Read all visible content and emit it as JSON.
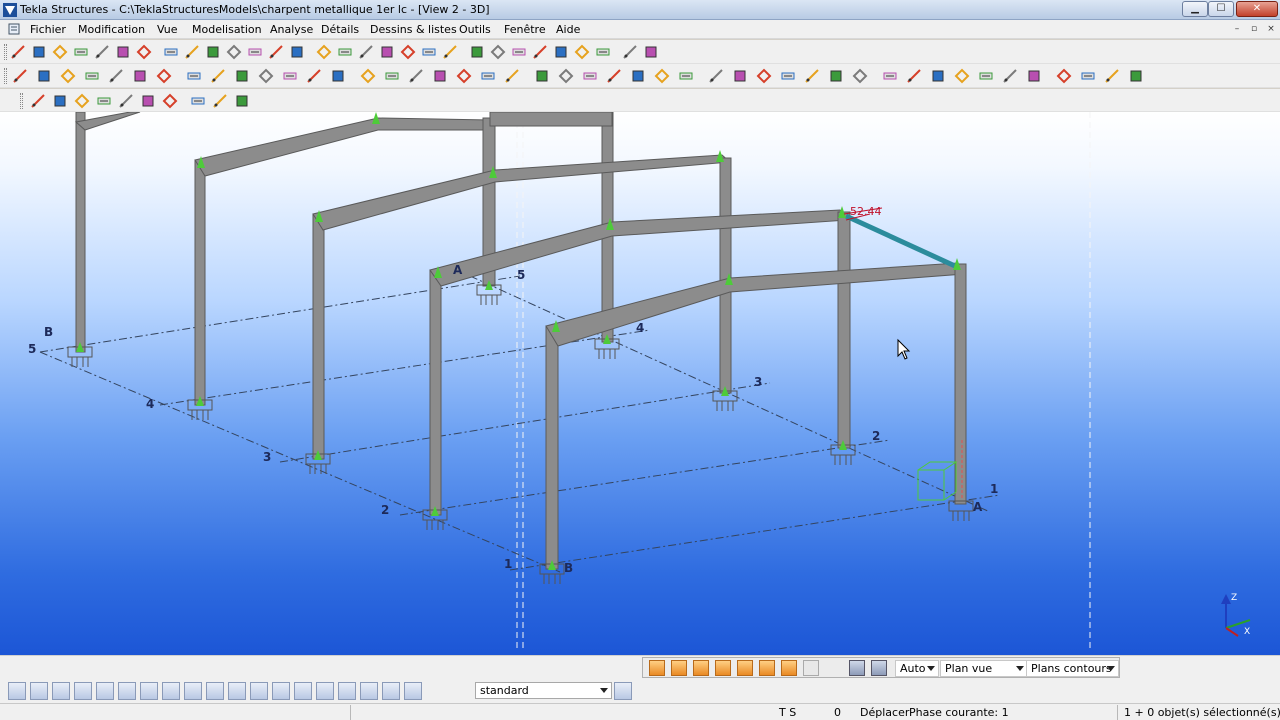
{
  "window": {
    "title": "Tekla Structures - C:\\TeklaStructuresModels\\charpent metallique 1er lc - [View 2 - 3D]",
    "minimize": "▁",
    "maximize": "☐",
    "close": "✕"
  },
  "menu": {
    "items": [
      "Fichier",
      "Modification",
      "Vue",
      "Modelisation",
      "Analyse",
      "Détails",
      "Dessins & listes",
      "Outils",
      "Fenêtre",
      "Aide"
    ],
    "mdi_minimize": "–",
    "mdi_restore": "▫",
    "mdi_close": "×"
  },
  "viewport": {
    "dimension_label": "52.44",
    "grid_labels": {
      "frame_numbers": [
        "1",
        "2",
        "3",
        "4",
        "5"
      ],
      "axis_letters": [
        "A",
        "B"
      ]
    },
    "axes_triad": {
      "z": "Z",
      "x": "X"
    }
  },
  "snap_bar": {
    "work_plane_handler": "Auto",
    "view_plane": "Plan vue",
    "contour_planes": "Plans contours"
  },
  "settings": {
    "selection_settings": "standard"
  },
  "status": {
    "ts": "T S",
    "counter": "0",
    "command": "Déplacer",
    "phase": "Phase courante: 1",
    "selection": "1 + 0 objet(s) sélectionné(s)"
  },
  "colors": {
    "steel": "#8c8c8c",
    "selected_member": "#2c8c9c",
    "grid_line": "#34445e",
    "marker": "#4ecb3a"
  },
  "icons": {
    "tb1": [
      "point-icon",
      "point-on-line-icon",
      "point-on-plane-icon",
      "intersection-point-icon",
      "arc-point-icon",
      "circle-point-icon",
      "grid-icon",
      "gridline-icon",
      "view-icon",
      "viewport-icon",
      "prev-view-icon",
      "next-view-icon",
      "three-d-icon",
      "zoom-in-icon",
      "zoom-out-icon",
      "zoom-window-icon",
      "zoom-all-icon",
      "center-icon",
      "pan-icon",
      "rotate-icon",
      "fly-icon",
      "clip-plane-icon",
      "work-area-icon",
      "dim-icon",
      "measure-icon",
      "distance-icon",
      "angle-icon",
      "bolt-distance-icon",
      "filter-icon",
      "layer-icon"
    ],
    "tb2": [
      "column-icon",
      "beam-icon",
      "polybeam-icon",
      "curved-beam-icon",
      "contour-plate-icon",
      "bolt-icon",
      "weld-icon",
      "fitting-icon",
      "component-icon",
      "cut-icon",
      "polygon-cut-icon",
      "new-icon",
      "open-icon",
      "save-icon",
      "undo-icon",
      "redo-icon",
      "copy-icon",
      "move-icon",
      "mirror-icon",
      "properties-icon",
      "select-all-icon",
      "select-parts-icon",
      "select-assembly-icon",
      "select-objects-icon",
      "select-points-icon",
      "drawing-icon",
      "single-drawing-icon",
      "assembly-drawing-icon",
      "cast-drawing-icon",
      "report-icon",
      "numbering-icon",
      "inquire-icon",
      "help-icon",
      "snap-end-icon",
      "snap-mid-icon",
      "snap-intersect-icon",
      "snap-perp-icon",
      "snap-line-icon",
      "analysis-icon",
      "load-icon",
      "catalog-icon",
      "profile-icon",
      "material-icon",
      "web-icon",
      "macro-icon",
      "tools-icon"
    ],
    "tb3": [
      "solid-icon",
      "wireframe-icon",
      "beam-rep-icon",
      "line-rep-icon",
      "slab-icon",
      "panel-icon",
      "hatch-icon",
      "magnet-icon",
      "rotate-tool-icon",
      "mesh-icon"
    ],
    "bottom": [
      "select-icon",
      "select-components-icon",
      "select-parts-bottom-icon",
      "select-surface-icon",
      "select-bolts-icon",
      "select-welds-icon",
      "select-grids-icon",
      "select-lines-icon",
      "select-cuts-icon",
      "select-planes-icon",
      "select-points-bottom-icon",
      "select-views-icon",
      "select-holes-icon",
      "select-loads-icon",
      "select-reference-icon",
      "select-assemblies-icon",
      "select-component-objects-icon",
      "select-subassemblies-icon",
      "select-bolt-groups-icon",
      "settings-icon"
    ]
  }
}
